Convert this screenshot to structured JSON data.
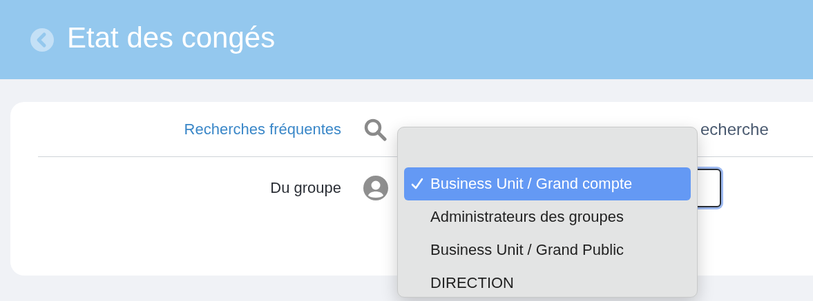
{
  "header": {
    "title": "Etat des congés"
  },
  "form": {
    "rows": [
      {
        "kind": "search",
        "label": "Recherches fréquentes",
        "field_text": "echerche"
      },
      {
        "kind": "group",
        "label": "Du groupe"
      }
    ]
  },
  "dropdown": {
    "options": [
      {
        "label": "Business Unit / Grand compte",
        "selected": true
      },
      {
        "label": "Administrateurs des groupes",
        "selected": false
      },
      {
        "label": "Business Unit / Grand Public",
        "selected": false
      },
      {
        "label": "DIRECTION",
        "selected": false
      }
    ]
  }
}
